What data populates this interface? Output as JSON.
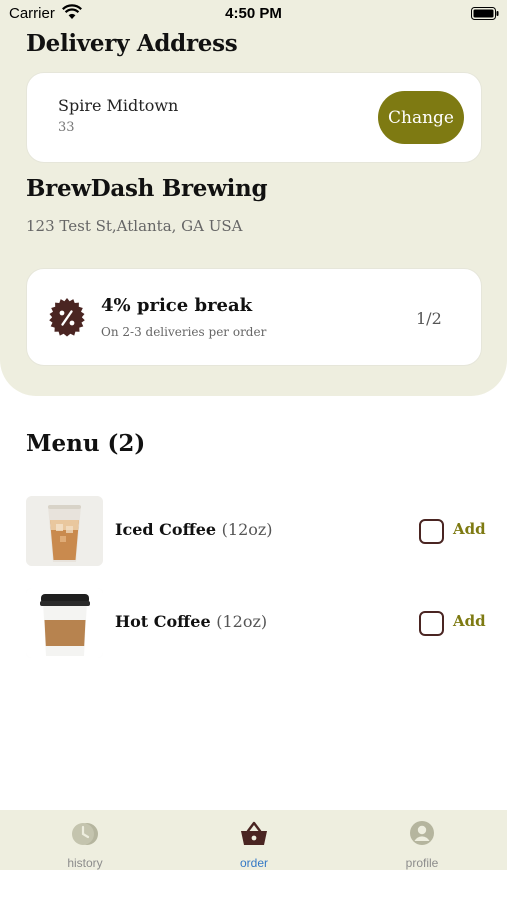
{
  "status_bar": {
    "carrier": "Carrier",
    "time": "4:50 PM"
  },
  "delivery": {
    "title": "Delivery Address",
    "name": "Spire Midtown",
    "sub": "33",
    "change_label": "Change"
  },
  "brewery": {
    "name": "BrewDash Brewing",
    "address": "123 Test St,Atlanta, GA USA"
  },
  "promo": {
    "title": "4% price break",
    "subtitle": "On 2-3 deliveries per order",
    "page": "1/2",
    "icon": "percent-badge-icon"
  },
  "menu": {
    "title": "Menu (2)",
    "items": [
      {
        "name": "Iced Coffee",
        "size": "(12oz)",
        "add_label": "Add",
        "checked": false
      },
      {
        "name": "Hot Coffee",
        "size": "(12oz)",
        "add_label": "Add",
        "checked": false
      }
    ]
  },
  "tabs": [
    {
      "label": "history",
      "icon": "history-icon",
      "active": false
    },
    {
      "label": "order",
      "icon": "basket-icon",
      "active": true
    },
    {
      "label": "profile",
      "icon": "profile-icon",
      "active": false
    }
  ],
  "colors": {
    "panel": "#eeeedf",
    "accent": "#7e7a12",
    "brand_dark": "#4a2522",
    "active_tab": "#3478c6"
  }
}
